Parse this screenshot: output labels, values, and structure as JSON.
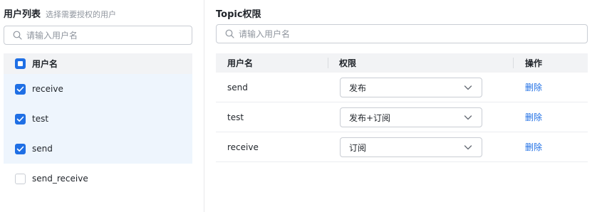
{
  "left_panel": {
    "title": "用户列表",
    "subtitle": "选择需要授权的用户",
    "search_placeholder": "请输入用户名",
    "header_label": "用户名",
    "users": [
      {
        "name": "receive",
        "checked": true
      },
      {
        "name": "test",
        "checked": true
      },
      {
        "name": "send",
        "checked": true
      },
      {
        "name": "send_receive",
        "checked": false
      }
    ]
  },
  "right_panel": {
    "title": "Topic权限",
    "search_placeholder": "请输入用户名",
    "columns": {
      "user": "用户名",
      "permission": "权限",
      "action": "操作"
    },
    "rows": [
      {
        "user": "send",
        "permission": "发布",
        "action": "删除"
      },
      {
        "user": "test",
        "permission": "发布+订阅",
        "action": "删除"
      },
      {
        "user": "receive",
        "permission": "订阅",
        "action": "删除"
      }
    ]
  },
  "colors": {
    "accent": "#1f6fe5",
    "selected_bg": "#eef5fd",
    "header_bg": "#f2f3f5"
  }
}
